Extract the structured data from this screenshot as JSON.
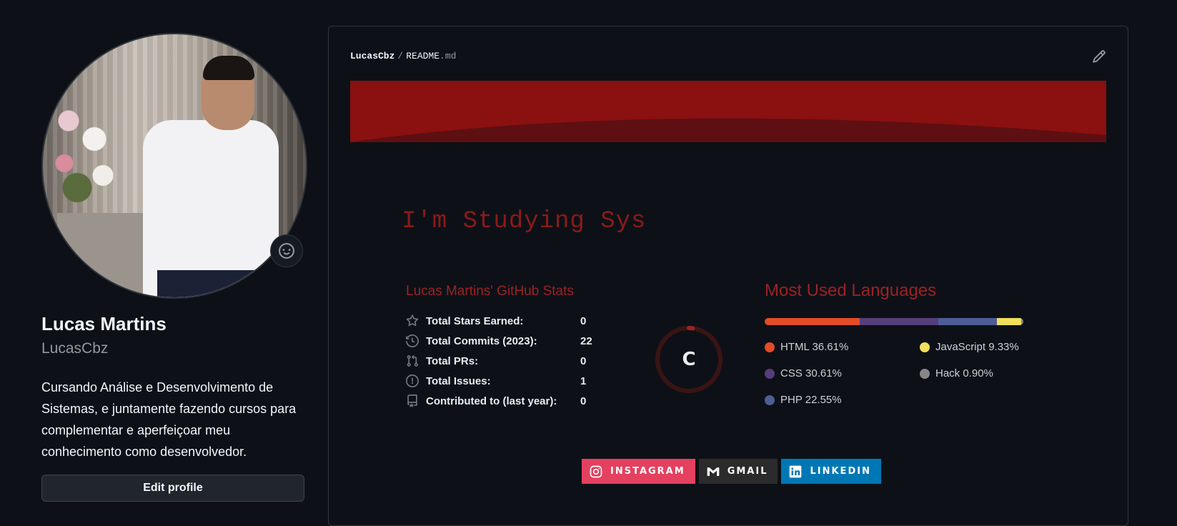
{
  "profile": {
    "name": "Lucas Martins",
    "login": "LucasCbz",
    "bio": "Cursando Análise e Desenvolvimento de Sistemas, e juntamente fazendo cursos para complementar e aperfeiçoar meu conhecimento como desenvolvedor.",
    "edit_label": "Edit profile",
    "status_icon": "smiley-icon"
  },
  "readme": {
    "owner": "LucasCbz",
    "separator": "/",
    "file_name": "README",
    "file_ext": ".md",
    "edit_icon": "pencil-icon",
    "banner_color": "#8b1010",
    "typing_text": "I'm Studying Sys",
    "accent_color": "#9b2226"
  },
  "stats": {
    "title": "Lucas Martins' GitHub Stats",
    "rows": [
      {
        "icon": "star-icon",
        "label": "Total Stars Earned:",
        "value": "0"
      },
      {
        "icon": "history-icon",
        "label": "Total Commits (2023):",
        "value": "22"
      },
      {
        "icon": "pull-request-icon",
        "label": "Total PRs:",
        "value": "0"
      },
      {
        "icon": "issue-icon",
        "label": "Total Issues:",
        "value": "1"
      },
      {
        "icon": "repo-icon",
        "label": "Contributed to (last year):",
        "value": "0"
      }
    ],
    "rank": "C",
    "rank_progress": 0.02
  },
  "languages": {
    "title": "Most Used Languages",
    "items": [
      {
        "name": "HTML",
        "percent": 36.61,
        "label": "HTML 36.61%",
        "color": "#e34c26"
      },
      {
        "name": "CSS",
        "percent": 30.61,
        "label": "CSS 30.61%",
        "color": "#563d7c"
      },
      {
        "name": "PHP",
        "percent": 22.55,
        "label": "PHP 22.55%",
        "color": "#4f5d95"
      },
      {
        "name": "JavaScript",
        "percent": 9.33,
        "label": "JavaScript 9.33%",
        "color": "#f1e05a"
      },
      {
        "name": "Hack",
        "percent": 0.9,
        "label": "Hack 0.90%",
        "color": "#878787"
      }
    ]
  },
  "social": [
    {
      "label": "INSTAGRAM",
      "icon": "instagram-icon",
      "color": "#e4405f"
    },
    {
      "label": "GMAIL",
      "icon": "gmail-icon",
      "color": "#2b2b2b"
    },
    {
      "label": "LINKEDIN",
      "icon": "linkedin-icon",
      "color": "#0077b5"
    }
  ]
}
